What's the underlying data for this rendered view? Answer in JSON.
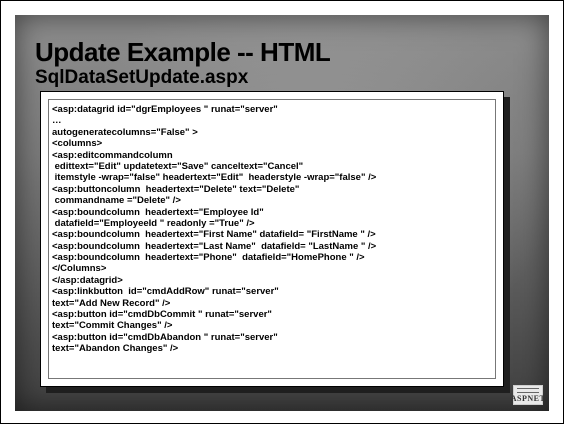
{
  "slide": {
    "title": "Update Example -- HTML",
    "subtitle": "SqlDataSetUpdate.aspx",
    "code_lines": [
      "<asp:datagrid id=\"dgrEmployees \" runat=\"server\"",
      "…",
      "autogeneratecolumns=\"False\" >",
      "<columns>",
      "<asp:editcommandcolumn",
      " edittext=\"Edit\" updatetext=\"Save\" canceltext=\"Cancel\"",
      " itemstyle -wrap=\"false\" headertext=\"Edit\"  headerstyle -wrap=\"false\" />",
      "<asp:buttoncolumn  headertext=\"Delete\" text=\"Delete\"",
      " commandname =\"Delete\" />",
      "<asp:boundcolumn  headertext=\"Employee Id\"",
      " datafield=\"EmployeeId \" readonly =\"True\" />",
      "<asp:boundcolumn  headertext=\"First Name\" datafield= \"FirstName \" />",
      "<asp:boundcolumn  headertext=\"Last Name\"  datafield= \"LastName \" />",
      "<asp:boundcolumn  headertext=\"Phone\"  datafield=\"HomePhone \" />",
      "</Columns>",
      "</asp:datagrid>",
      "<asp:linkbutton  id=\"cmdAddRow\" runat=\"server\"",
      "text=\"Add New Record\" />",
      "<asp:button id=\"cmdDbCommit \" runat=\"server\"",
      "text=\"Commit Changes\" />",
      "<asp:button id=\"cmdDbAbandon \" runat=\"server\"",
      "text=\"Abandon Changes\" />"
    ],
    "logo_text": "ASPNET"
  }
}
